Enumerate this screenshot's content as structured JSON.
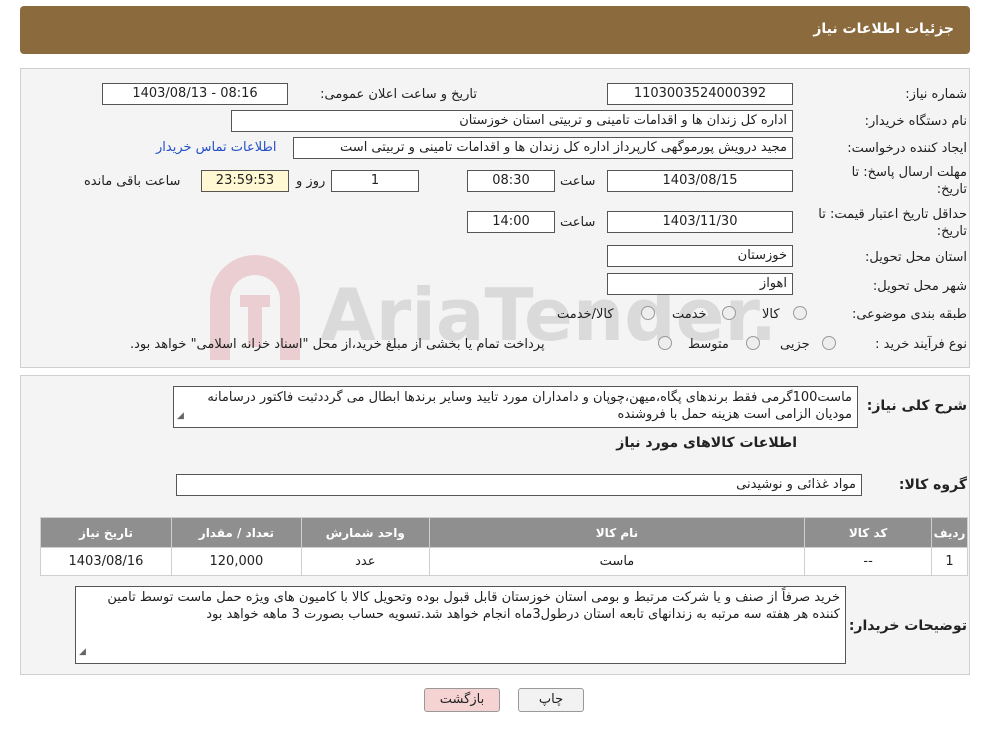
{
  "header": {
    "title": "جزئیات اطلاعات نیاز"
  },
  "form": {
    "need_number_label": "شماره نیاز:",
    "need_number": "1103003524000392",
    "announce_label": "تاریخ و ساعت اعلان عمومی:",
    "announce_value": "1403/08/13 - 08:16",
    "buyer_org_label": "نام دستگاه خریدار:",
    "buyer_org": "اداره کل زندان ها و اقدامات تامینی و تربیتی استان خوزستان",
    "creator_label": "ایجاد کننده درخواست:",
    "creator": "مجید درویش پورموگهی کارپرداز اداره کل زندان ها و اقدامات تامینی و تربیتی است",
    "contact_link": "اطلاعات تماس خریدار",
    "deadline_label_1": "مهلت ارسال پاسخ: تا",
    "deadline_label_2": "تاریخ:",
    "deadline_date": "1403/08/15",
    "time_label": "ساعت",
    "deadline_time": "08:30",
    "days_value": "1",
    "days_label": "روز و",
    "remaining_time": "23:59:53",
    "remaining_label": "ساعت باقی مانده",
    "validity_label_1": "حداقل تاریخ اعتبار قیمت: تا",
    "validity_label_2": "تاریخ:",
    "validity_date": "1403/11/30",
    "validity_time": "14:00",
    "province_label": "استان محل تحویل:",
    "province": "خوزستان",
    "city_label": "شهر محل تحویل:",
    "city": "اهواز",
    "category_label": "طبقه بندی موضوعی:",
    "category_options": [
      "کالا",
      "خدمت",
      "کالا/خدمت"
    ],
    "purchase_type_label": "نوع فرآیند خرید :",
    "purchase_options": [
      "جزیی",
      "متوسط"
    ],
    "purchase_note": "پرداخت تمام یا بخشی از مبلغ خرید،از محل \"اسناد خزانه اسلامی\" خواهد بود."
  },
  "summary": {
    "label": "شرح کلی نیاز:",
    "text": "ماست100گرمی فقط برندهای پگاه،میهن،چوپان و دامداران مورد تایید وسایر برندها ابطال می گرددثبت فاکتور درسامانه مودیان الزامی است هزینه حمل با فروشنده"
  },
  "items_title": "اطلاعات کالاهای مورد نیاز",
  "goods_group": {
    "label": "گروه کالا:",
    "value": "مواد غذائی و نوشیدنی"
  },
  "table": {
    "headers": [
      "ردیف",
      "کد کالا",
      "نام کالا",
      "واحد شمارش",
      "تعداد / مقدار",
      "تاریخ نیاز"
    ],
    "rows": [
      [
        "1",
        "--",
        "ماست",
        "عدد",
        "120,000",
        "1403/08/16"
      ]
    ]
  },
  "buyer_notes": {
    "label": "توضیحات خریدار:",
    "text": "خرید صرفاً از صنف و یا شرکت مرتبط  و بومی استان خوزستان قابل قبول بوده وتحویل کالا با کامیون های ویژه حمل ماست  توسط تامین کننده هر هفته سه مرتبه به زندانهای تابعه استان درطول3ماه انجام خواهد شد.تسویه حساب بصورت 3 ماهه خواهد بود"
  },
  "buttons": {
    "print": "چاپ",
    "back": "بازگشت"
  },
  "watermark": {
    "text": "AriaTender.neT"
  },
  "colors": {
    "header": "#8b6b3e",
    "link": "#2450c8",
    "table_header": "#8f8f8f",
    "back_button": "#f6d3d3",
    "remaining_bg": "#fff8d2"
  }
}
